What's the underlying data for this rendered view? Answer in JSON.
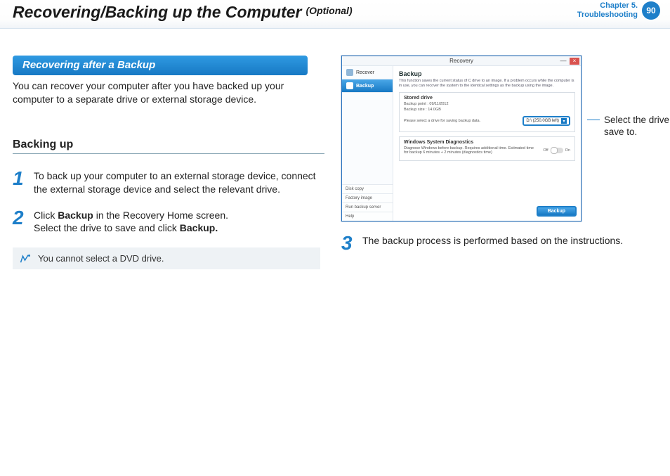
{
  "header": {
    "title": "Recovering/Backing up the Computer",
    "suffix": "(Optional)",
    "chapter_line1": "Chapter 5.",
    "chapter_line2": "Troubleshooting",
    "page_number": "90"
  },
  "section": {
    "pill": "Recovering after a Backup",
    "intro": "You can recover your computer after you have backed up your computer to a separate drive or external storage device.",
    "subheading": "Backing up",
    "steps": {
      "n1": "1",
      "t1": "To back up your computer to an external storage device, connect the external storage device and select the relevant drive.",
      "n2": "2",
      "t2a": "Click ",
      "t2b": "Backup",
      "t2c": " in the Recovery Home screen.",
      "t2d": "Select the drive to save and click ",
      "t2e": "Backup.",
      "n3": "3",
      "t3": "The backup process is performed based on the instructions."
    },
    "note": "You cannot select a DVD drive."
  },
  "screenshot": {
    "window_title": "Recovery",
    "min": "—",
    "close": "×",
    "side": {
      "recover": "Recover",
      "backup": "Backup",
      "bottom1": "Disk copy",
      "bottom2": "Factory image",
      "bottom3": "Run backup server",
      "bottom4": "Help"
    },
    "main": {
      "h": "Backup",
      "desc": "This function saves the current status of C drive to an image. If a problem occurs while the computer is in use, you can recover the system to the identical settings as the backup using the image.",
      "box1_title": "Stored drive",
      "box1_line1": "Backup point : 09/11/2012",
      "box1_line2": "Backup size : 14.0GB",
      "box1_prompt": "Please select a drive for saving backup data.",
      "drive_value": "D:\\ (250.0GB left)",
      "box2_title": "Windows System Diagnostics",
      "box2_line": "Diagnose Windows before backup. Requires additional time. Estimated time for backup 6 minutes + 2 minutes (diagnostics time)",
      "toggle_off": "Off",
      "toggle_on": "On",
      "backup_btn": "Backup"
    }
  },
  "callout": {
    "text": "Select the drive to save to."
  }
}
